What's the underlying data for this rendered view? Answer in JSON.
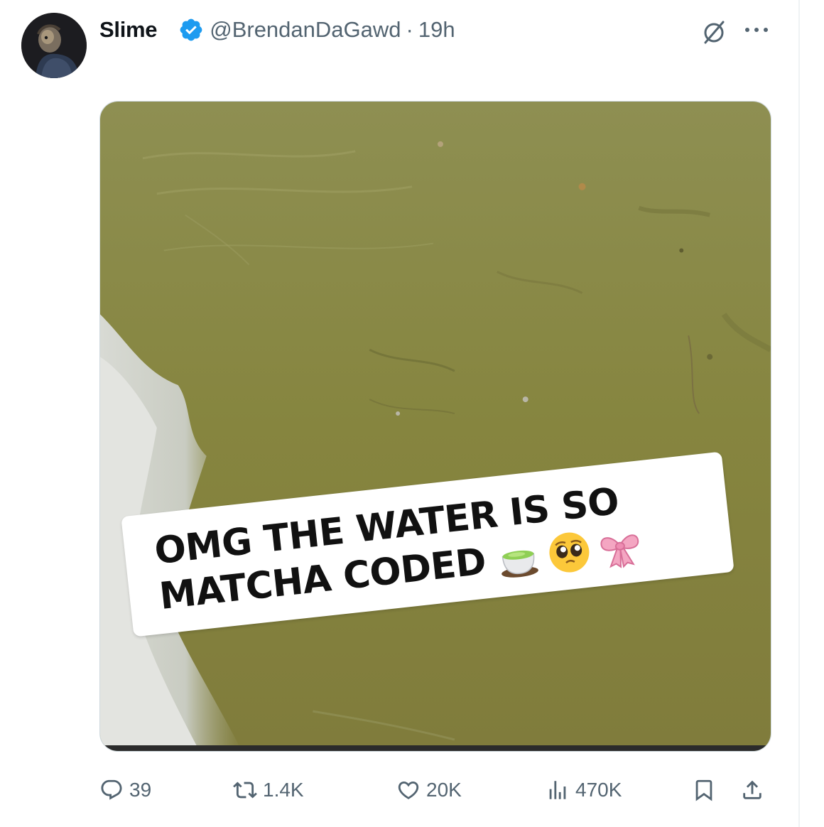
{
  "post": {
    "author": {
      "display_name": "Slime",
      "handle": "@BrendanDaGawd",
      "separator": "·",
      "time": "19h",
      "verified": true
    },
    "media": {
      "caption_line1": "OMG THE WATER IS SO",
      "caption_line2": "MATCHA CODED",
      "caption_emojis": [
        "tea-cup-emoji",
        "pleading-face-emoji",
        "pink-ribbon-emoji"
      ],
      "water_color": "#8a8a45"
    },
    "actions": {
      "replies": "39",
      "reposts": "1.4K",
      "likes": "20K",
      "views": "470K"
    }
  },
  "colors": {
    "text_primary": "#0f1419",
    "text_secondary": "#536471",
    "verified_blue": "#1d9bf0"
  },
  "icons": {
    "header": [
      "verified-badge-icon",
      "grok-icon",
      "more-icon"
    ],
    "actions": [
      "reply-icon",
      "repost-icon",
      "like-icon",
      "views-icon",
      "bookmark-icon",
      "share-icon"
    ]
  }
}
